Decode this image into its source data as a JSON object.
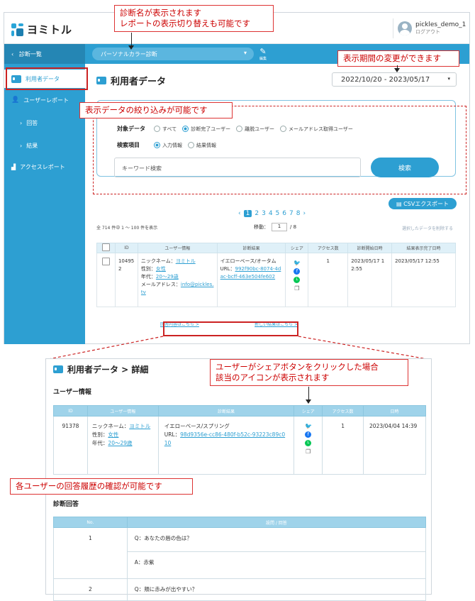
{
  "annotations": {
    "top1": "診断名が表示されます",
    "top2": "レポートの表示切り替えも可能です",
    "period": "表示期間の変更ができます",
    "filter": "表示データの絞り込みが可能です",
    "share1": "ユーザーがシェアボタンをクリックした場合",
    "share2": "該当のアイコンが表示されます",
    "history": "各ユーザーの回答履歴の確認が可能です"
  },
  "header": {
    "logo": "ヨミトル",
    "username": "pickles_demo_1",
    "logout": "ログアウト"
  },
  "sidebar": {
    "top": "診断一覧",
    "items": [
      {
        "label": "利用者データ"
      },
      {
        "label": "ユーザーレポート"
      },
      {
        "label": "回答"
      },
      {
        "label": "結果"
      },
      {
        "label": "アクセスレポート"
      }
    ]
  },
  "bluebar": {
    "diagnosis": "パーソナルカラー診断",
    "edit": "編集"
  },
  "page": {
    "title": "利用者データ",
    "period": "2022/10/20 - 2023/05/17"
  },
  "filter": {
    "target_label": "対象データ",
    "targets": [
      "すべて",
      "診断完了ユーザー",
      "離脱ユーザー",
      "メールアドレス取得ユーザー"
    ],
    "item_label": "検索項目",
    "items": [
      "入力情報",
      "結果情報"
    ],
    "keyword_placeholder": "キーワード検索",
    "search": "検索"
  },
  "list": {
    "csv": "CSVエクスポート",
    "pages": [
      "1",
      "2",
      "3",
      "4",
      "5",
      "6",
      "7",
      "8"
    ],
    "count": "全 714 件中 1 ～ 100 件を表示",
    "jump_label": "移動：",
    "jump_value": "1",
    "jump_total": "/ 8",
    "dl_selected": "選択したデータを削除する",
    "headers": [
      "ID",
      "ユーザー情報",
      "診断結果",
      "シェア",
      "アクセス数",
      "診断開始日時",
      "結果表示完了日時"
    ],
    "row": {
      "id": "104952",
      "nick_label": "ニックネーム：",
      "nick": "ヨミトル",
      "gender_label": "性別：",
      "gender": "女性",
      "age_label": "年代：",
      "age": "20～29歳",
      "mail_label": "メールアドレス：",
      "mail": "info@pickles.tv",
      "result": "イエローベース/オータム",
      "url_label": "URL：",
      "url": "992f90bc-8074-4dac-bcff-463e504fe602",
      "access": "1",
      "start": "2023/05/17 12:55",
      "end": "2023/05/17 12:55"
    },
    "link_answer": "回答内容はこちら >",
    "link_result": "新しい結果はこちら >"
  },
  "detail": {
    "title": "利用者データ > 詳細",
    "user_section": "ユーザー情報",
    "headers": [
      "ID",
      "ユーザー情報",
      "診断結果",
      "シェア",
      "アクセス数",
      "日時"
    ],
    "row": {
      "id": "91378",
      "nick_label": "ニックネーム：",
      "nick": "ヨミトル",
      "gender_label": "性別：",
      "gender": "女性",
      "age_label": "年代：",
      "age": "20～29歳",
      "result": "イエローベース/スプリング",
      "url_label": "URL：",
      "url": "98d9356e-cc86-480f-b52c-93223c89c010",
      "access": "1",
      "date": "2023/04/04 14:39"
    },
    "answer_section": "診断回答",
    "qa_headers": [
      "No.",
      "設問 / 回答"
    ],
    "qa": [
      {
        "no": "1",
        "q": "Q：あなたの唇の色は？",
        "a": "A：赤紫"
      },
      {
        "no": "2",
        "q": "Q：頬に赤みが出やすい？"
      }
    ]
  },
  "colors": {
    "brand": "#2d9fd2",
    "annotation": "#cc2222"
  }
}
